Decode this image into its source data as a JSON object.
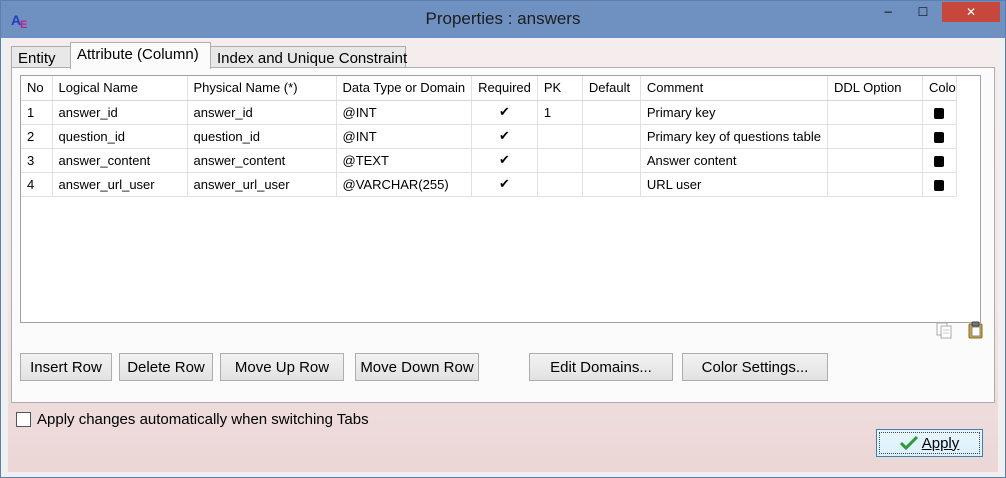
{
  "window": {
    "title": "Properties : answers",
    "controls": {
      "minimize": "−",
      "maximize": "☐",
      "close": "✕"
    }
  },
  "tabs": [
    {
      "label": "Entity",
      "active": false
    },
    {
      "label": "Attribute (Column)",
      "active": true
    },
    {
      "label": "Index and Unique Constraint",
      "active": false
    }
  ],
  "grid": {
    "columns": [
      "No",
      "Logical Name",
      "Physical Name (*)",
      "Data Type or Domain",
      "Required",
      "PK",
      "Default",
      "Comment",
      "DDL Option",
      "Colo"
    ],
    "rows": [
      {
        "no": "1",
        "logical": "answer_id",
        "physical": "answer_id",
        "type": "@INT",
        "required": "✔",
        "pk": "1",
        "default": "",
        "comment": "Primary key",
        "ddl": ""
      },
      {
        "no": "2",
        "logical": "question_id",
        "physical": "question_id",
        "type": "@INT",
        "required": "✔",
        "pk": "",
        "default": "",
        "comment": "Primary key of questions table",
        "ddl": ""
      },
      {
        "no": "3",
        "logical": "answer_content",
        "physical": "answer_content",
        "type": "@TEXT",
        "required": "✔",
        "pk": "",
        "default": "",
        "comment": "Answer content",
        "ddl": ""
      },
      {
        "no": "4",
        "logical": "answer_url_user",
        "physical": "answer_url_user",
        "type": "@VARCHAR(255)",
        "required": "✔",
        "pk": "",
        "default": "",
        "comment": "URL user",
        "ddl": ""
      }
    ]
  },
  "icons": {
    "copy": "copy-icon",
    "paste": "paste-icon",
    "check": "check-icon"
  },
  "buttons": {
    "insert_row": "Insert Row",
    "delete_row": "Delete Row",
    "move_up": "Move Up Row",
    "move_down": "Move Down Row",
    "edit_domains": "Edit Domains...",
    "color_settings": "Color Settings..."
  },
  "footer": {
    "auto_apply_label": "Apply changes automatically when switching Tabs",
    "auto_apply_checked": false,
    "apply_label": "Apply"
  },
  "colors": {
    "title_bar": "#6f91c2",
    "close_button": "#c7473c",
    "apply_check": "#2e9a3a"
  }
}
